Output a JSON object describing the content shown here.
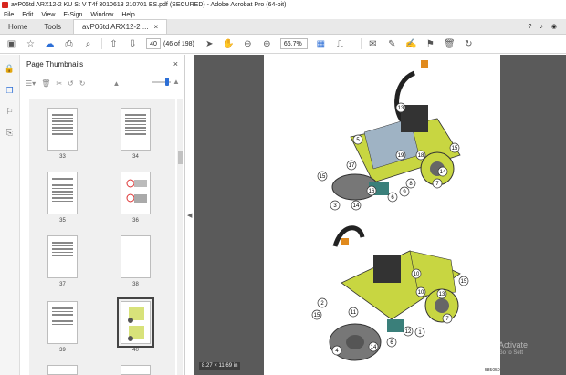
{
  "window": {
    "title": "avP06td ARX12-2 KU St V T4f 3010613 210701 ES.pdf (SECURED) - Adobe Acrobat Pro (64-bit)"
  },
  "menu": [
    "File",
    "Edit",
    "View",
    "E-Sign",
    "Window",
    "Help"
  ],
  "tabs": {
    "home": "Home",
    "tools": "Tools",
    "doc": "avP06td ARX12-2 ...",
    "doc_close": "×"
  },
  "toolbar": {
    "page_number": "40",
    "page_info": "(46 of 198)",
    "zoom": "66.7%"
  },
  "panel": {
    "title": "Page Thumbnails",
    "close": "×",
    "thumbnails": [
      {
        "label": "33"
      },
      {
        "label": "34"
      },
      {
        "label": "35"
      },
      {
        "label": "36"
      },
      {
        "label": "37"
      },
      {
        "label": "38"
      },
      {
        "label": "39"
      },
      {
        "label": "40"
      }
    ]
  },
  "document": {
    "page_size": "8.27 × 11.69 in",
    "doc_id": "585050",
    "callouts_top": [
      "13",
      "5",
      "18",
      "19",
      "15",
      "17",
      "14",
      "15",
      "9",
      "7",
      "8",
      "6",
      "16",
      "3",
      "14"
    ],
    "callouts_bottom": [
      "10",
      "15",
      "2",
      "11",
      "15",
      "12",
      "1",
      "7",
      "10",
      "13",
      "6",
      "4",
      "14"
    ],
    "watermark_title": "Activate",
    "watermark_sub": "Go to Sett"
  },
  "colors": {
    "accent": "#2d6fd6",
    "machine_yellow": "#c8d641",
    "doc_bg": "#5a5a5a"
  }
}
